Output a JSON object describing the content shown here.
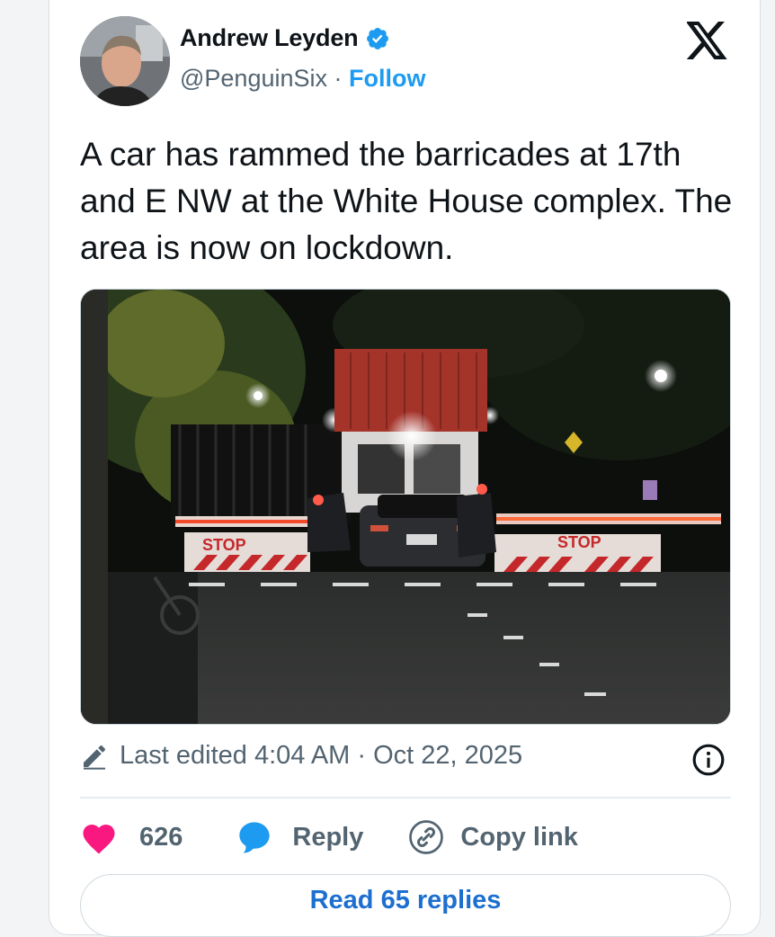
{
  "author": {
    "name": "Andrew Leyden",
    "handle": "@PenguinSix",
    "separator": "·",
    "follow_label": "Follow",
    "verified": true
  },
  "tweet": {
    "text": "A car has rammed the barricades at 17th and E NW at the White House complex. The area is now on lockdown.",
    "image_sign_text_left": "STOP",
    "image_sign_text_right": "STOP"
  },
  "edited": {
    "label": "Last edited 4:04 AM · Oct 22, 2025"
  },
  "actions": {
    "like_count": "626",
    "reply_label": "Reply",
    "copy_link_label": "Copy link"
  },
  "footer": {
    "read_replies_label": "Read 65 replies"
  },
  "colors": {
    "accent_blue": "#1d9bf0",
    "like_pink": "#f91880",
    "muted_text": "#536471",
    "text": "#0f1419"
  },
  "icons": [
    "verified-badge-icon",
    "x-logo-icon",
    "pencil-icon",
    "info-icon",
    "heart-icon",
    "reply-bubble-icon",
    "link-icon"
  ]
}
